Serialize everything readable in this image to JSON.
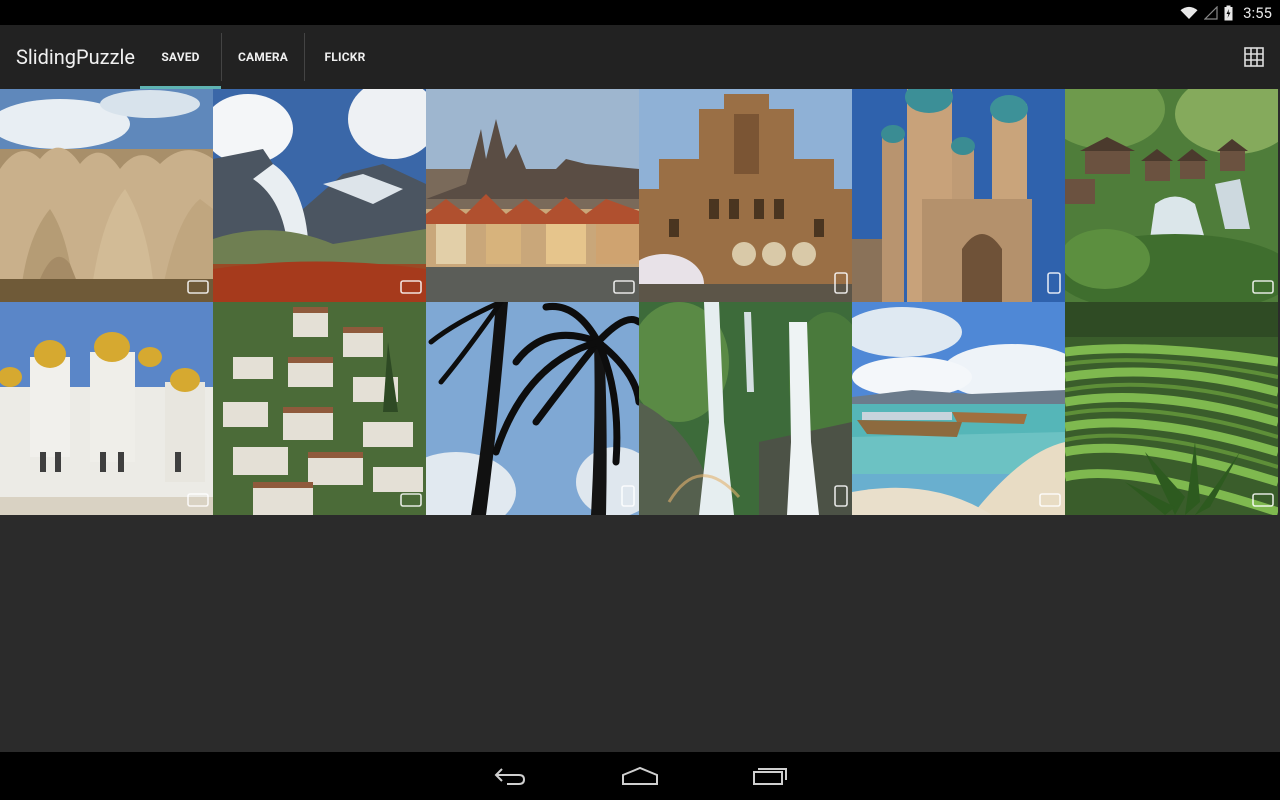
{
  "status_bar": {
    "time": "3:55",
    "icons": [
      "wifi-icon",
      "signal-icon",
      "battery-charging-icon"
    ]
  },
  "action_bar": {
    "title": "SlidingPuzzle",
    "tabs": [
      {
        "label": "SAVED",
        "active": true
      },
      {
        "label": "CAMERA",
        "active": false
      },
      {
        "label": "FLICKR",
        "active": false
      }
    ],
    "grid_button_icon": "grid-view-icon",
    "accent_color": "#5fb3b3"
  },
  "photos": [
    {
      "subject": "rock-formations",
      "orientation": "landscape"
    },
    {
      "subject": "glacier-mountains",
      "orientation": "landscape"
    },
    {
      "subject": "castle-city",
      "orientation": "landscape"
    },
    {
      "subject": "brick-palace",
      "orientation": "portrait"
    },
    {
      "subject": "minaret-towers",
      "orientation": "portrait"
    },
    {
      "subject": "mill-waterfall-village",
      "orientation": "landscape"
    },
    {
      "subject": "golden-domed-church",
      "orientation": "landscape"
    },
    {
      "subject": "hillside-town",
      "orientation": "landscape"
    },
    {
      "subject": "palm-silhouettes",
      "orientation": "portrait"
    },
    {
      "subject": "twin-waterfall",
      "orientation": "portrait"
    },
    {
      "subject": "beach-boats",
      "orientation": "landscape"
    },
    {
      "subject": "rice-terraces",
      "orientation": "landscape"
    }
  ],
  "nav_bar": {
    "icons": [
      "back-icon",
      "home-icon",
      "recent-apps-icon"
    ]
  }
}
